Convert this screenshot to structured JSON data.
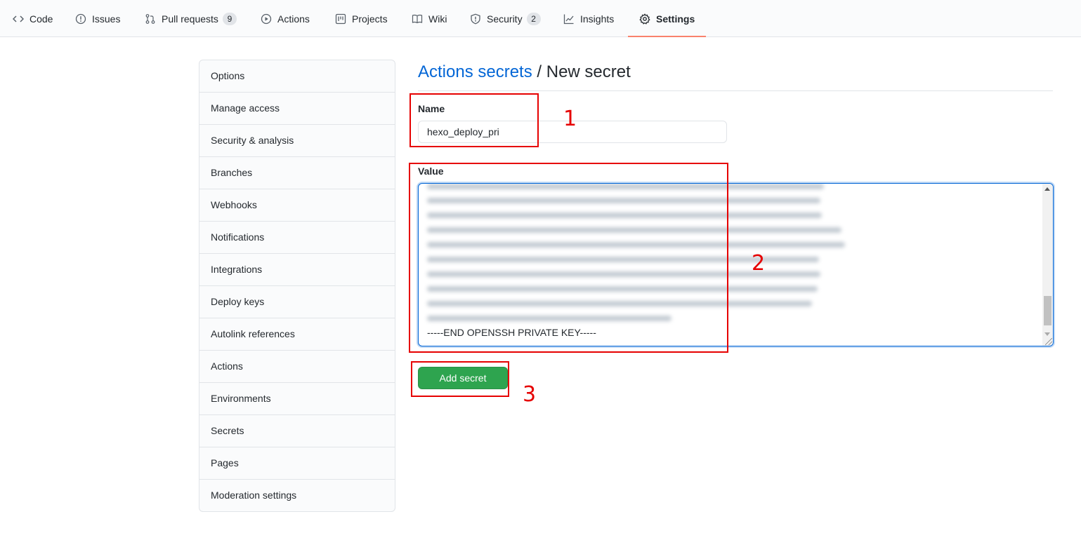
{
  "repo_nav": {
    "tabs": [
      {
        "label": "Code",
        "icon": "code-icon"
      },
      {
        "label": "Issues",
        "icon": "issue-icon"
      },
      {
        "label": "Pull requests",
        "icon": "pull-request-icon",
        "count": "9"
      },
      {
        "label": "Actions",
        "icon": "play-icon"
      },
      {
        "label": "Projects",
        "icon": "project-icon"
      },
      {
        "label": "Wiki",
        "icon": "book-icon"
      },
      {
        "label": "Security",
        "icon": "shield-icon",
        "count": "2"
      },
      {
        "label": "Insights",
        "icon": "graph-icon"
      },
      {
        "label": "Settings",
        "icon": "gear-icon",
        "selected": true
      }
    ]
  },
  "sidebar": {
    "items": [
      {
        "label": "Options"
      },
      {
        "label": "Manage access"
      },
      {
        "label": "Security & analysis"
      },
      {
        "label": "Branches"
      },
      {
        "label": "Webhooks"
      },
      {
        "label": "Notifications"
      },
      {
        "label": "Integrations"
      },
      {
        "label": "Deploy keys"
      },
      {
        "label": "Autolink references"
      },
      {
        "label": "Actions"
      },
      {
        "label": "Environments"
      },
      {
        "label": "Secrets"
      },
      {
        "label": "Pages"
      },
      {
        "label": "Moderation settings"
      }
    ]
  },
  "main": {
    "breadcrumb_link": "Actions secrets",
    "breadcrumb_separator": " / ",
    "title": "New secret",
    "name_label": "Name",
    "name_value": "hexo_deploy_pri",
    "value_label": "Value",
    "value_last_line": "-----END OPENSSH PRIVATE KEY-----",
    "add_button_label": "Add secret"
  },
  "annotations": {
    "color": "#e60000",
    "labels": [
      "1",
      "2",
      "3"
    ]
  },
  "colors": {
    "link": "#0366d6",
    "primary_button": "#2ea44f",
    "selected_tab_underline": "#f9826c"
  }
}
